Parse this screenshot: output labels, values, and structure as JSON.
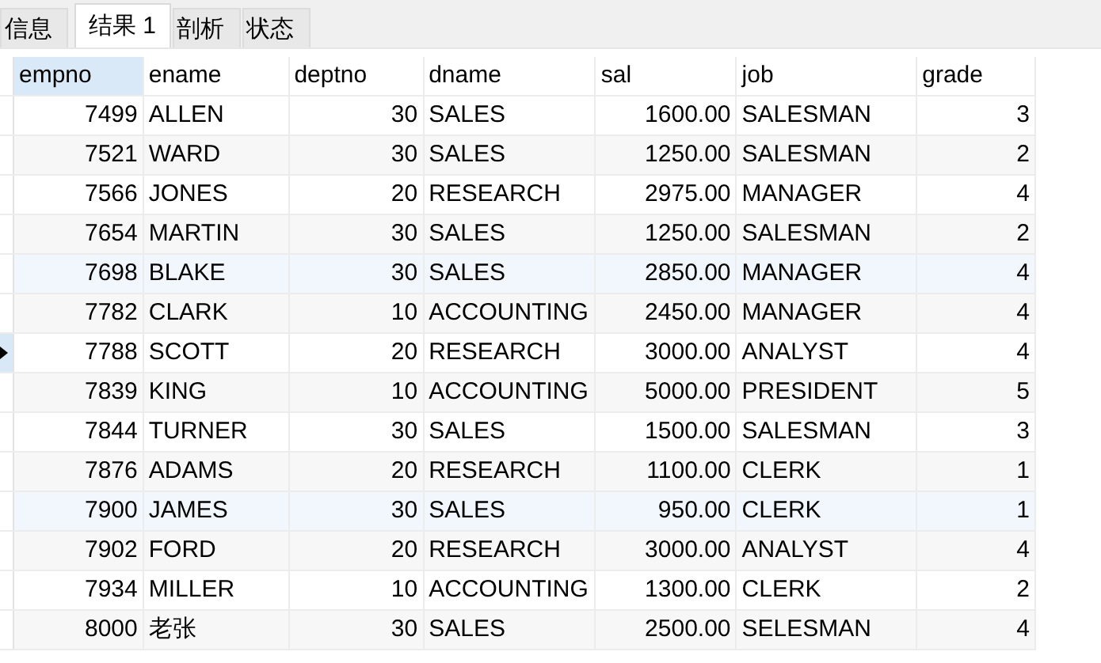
{
  "tabs": [
    {
      "label": "信息",
      "selected": false
    },
    {
      "label": "结果 1",
      "selected": true
    },
    {
      "label": "剖析",
      "selected": false
    },
    {
      "label": "状态",
      "selected": false
    }
  ],
  "table": {
    "columns": [
      {
        "label": "empno",
        "kind": "number",
        "selected": true
      },
      {
        "label": "ename",
        "kind": "text",
        "selected": false
      },
      {
        "label": "deptno",
        "kind": "number",
        "selected": false
      },
      {
        "label": "dname",
        "kind": "text",
        "selected": false
      },
      {
        "label": "sal",
        "kind": "number",
        "selected": false
      },
      {
        "label": "job",
        "kind": "text",
        "selected": false
      },
      {
        "label": "grade",
        "kind": "number",
        "selected": false
      }
    ],
    "rows": [
      {
        "cells": [
          "7499",
          "ALLEN",
          "30",
          "SALES",
          "1600.00",
          "SALESMAN",
          "3"
        ],
        "current": false,
        "highlighted": false
      },
      {
        "cells": [
          "7521",
          "WARD",
          "30",
          "SALES",
          "1250.00",
          "SALESMAN",
          "2"
        ],
        "current": false,
        "highlighted": false
      },
      {
        "cells": [
          "7566",
          "JONES",
          "20",
          "RESEARCH",
          "2975.00",
          "MANAGER",
          "4"
        ],
        "current": false,
        "highlighted": false
      },
      {
        "cells": [
          "7654",
          "MARTIN",
          "30",
          "SALES",
          "1250.00",
          "SALESMAN",
          "2"
        ],
        "current": false,
        "highlighted": false
      },
      {
        "cells": [
          "7698",
          "BLAKE",
          "30",
          "SALES",
          "2850.00",
          "MANAGER",
          "4"
        ],
        "current": false,
        "highlighted": true
      },
      {
        "cells": [
          "7782",
          "CLARK",
          "10",
          "ACCOUNTING",
          "2450.00",
          "MANAGER",
          "4"
        ],
        "current": false,
        "highlighted": false
      },
      {
        "cells": [
          "7788",
          "SCOTT",
          "20",
          "RESEARCH",
          "3000.00",
          "ANALYST",
          "4"
        ],
        "current": true,
        "highlighted": false
      },
      {
        "cells": [
          "7839",
          "KING",
          "10",
          "ACCOUNTING",
          "5000.00",
          "PRESIDENT",
          "5"
        ],
        "current": false,
        "highlighted": false
      },
      {
        "cells": [
          "7844",
          "TURNER",
          "30",
          "SALES",
          "1500.00",
          "SALESMAN",
          "3"
        ],
        "current": false,
        "highlighted": false
      },
      {
        "cells": [
          "7876",
          "ADAMS",
          "20",
          "RESEARCH",
          "1100.00",
          "CLERK",
          "1"
        ],
        "current": false,
        "highlighted": false
      },
      {
        "cells": [
          "7900",
          "JAMES",
          "30",
          "SALES",
          "950.00",
          "CLERK",
          "1"
        ],
        "current": false,
        "highlighted": true
      },
      {
        "cells": [
          "7902",
          "FORD",
          "20",
          "RESEARCH",
          "3000.00",
          "ANALYST",
          "4"
        ],
        "current": false,
        "highlighted": false
      },
      {
        "cells": [
          "7934",
          "MILLER",
          "10",
          "ACCOUNTING",
          "1300.00",
          "CLERK",
          "2"
        ],
        "current": false,
        "highlighted": false
      },
      {
        "cells": [
          "8000",
          "老张",
          "30",
          "SALES",
          "2500.00",
          "SELESMAN",
          "4"
        ],
        "current": false,
        "highlighted": false
      }
    ]
  }
}
